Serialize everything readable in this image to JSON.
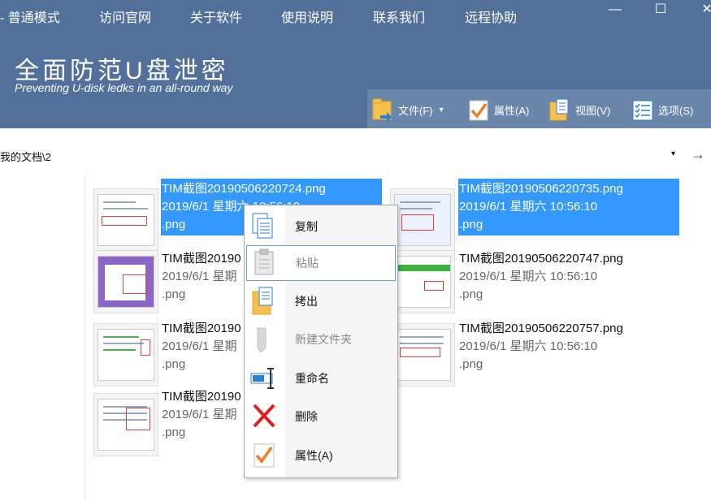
{
  "menubar": {
    "mode": "- 普通模式",
    "items": [
      "访问官网",
      "关于软件",
      "使用说明",
      "联系我们",
      "远程协助"
    ],
    "minimize": "—",
    "maximize": "☐",
    "close": "✕"
  },
  "app": {
    "title": "全面防范U盘泄密",
    "subtitle": "Preventing U-disk ledks in an all-round way"
  },
  "toolbar": {
    "file": "文件(F)",
    "file_dropdown": "▾",
    "properties": "属性(A)",
    "view": "视图(V)",
    "options": "选项(S)"
  },
  "pathbar": {
    "path": "我的文档\\2",
    "dropdown": "▾",
    "go": "→"
  },
  "files": [
    {
      "name": "TIM截图20190506220724.png",
      "date": "2019/6/1 星期六 10:56:10",
      "ext": ".png",
      "selected": true
    },
    {
      "name": "TIM截图20190506220735.png",
      "date": "2019/6/1 星期六 10:56:10",
      "ext": ".png",
      "selected": true
    },
    {
      "name": "TIM截图20190",
      "date": "2019/6/1 星期",
      "ext": ".png",
      "selected": false
    },
    {
      "name": "TIM截图20190506220747.png",
      "date": "2019/6/1 星期六 10:56:10",
      "ext": ".png",
      "selected": false
    },
    {
      "name": "TIM截图20190",
      "date": "2019/6/1 星期",
      "ext": ".png",
      "selected": false
    },
    {
      "name": "TIM截图20190506220757.png",
      "date": "2019/6/1 星期六 10:56:10",
      "ext": ".png",
      "selected": false
    },
    {
      "name": "TIM截图20190",
      "date": "2019/6/1 星期",
      "ext": ".png",
      "selected": false
    }
  ],
  "context_menu": {
    "copy": "复制",
    "paste": "粘贴",
    "export": "拷出",
    "new_folder": "新建文件夹",
    "rename": "重命名",
    "delete": "删除",
    "properties": "属性(A)"
  },
  "colors": {
    "header": "#52709a",
    "toolbar": "#6a86aa",
    "selection": "#3399ff",
    "delete_icon": "#e02020"
  }
}
